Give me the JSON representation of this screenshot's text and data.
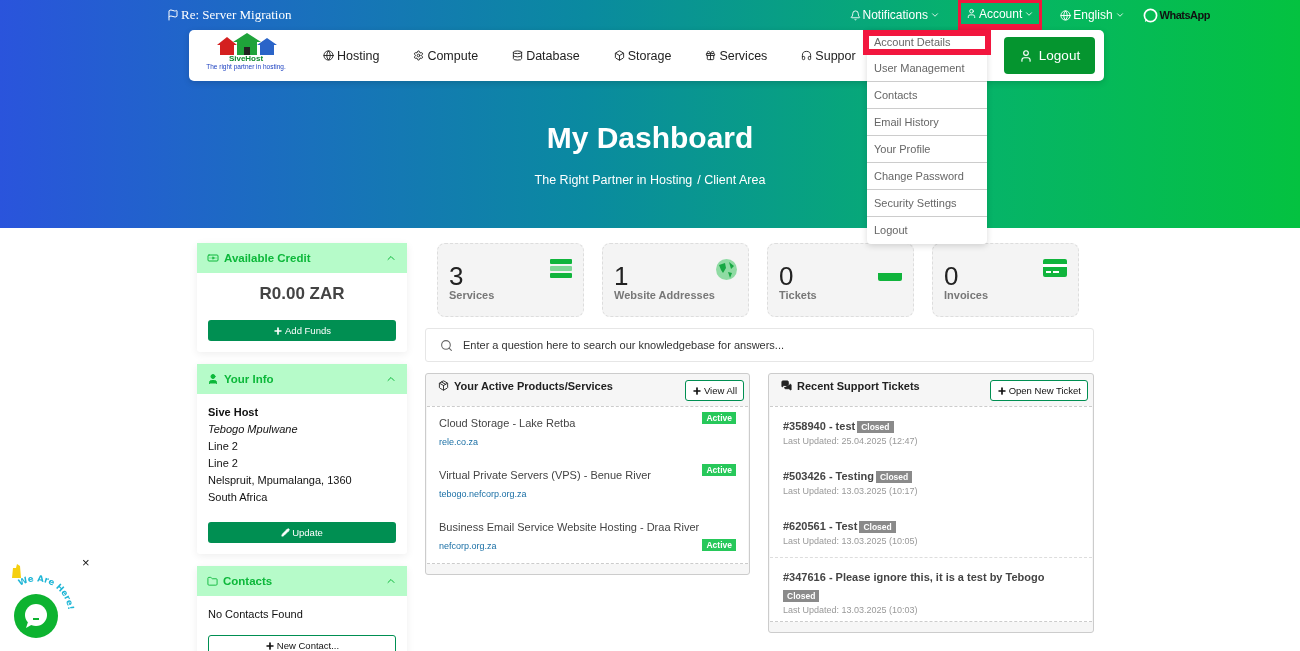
{
  "top_bar": {
    "announcement": "Re: Server Migration",
    "links": [
      {
        "label": "Notifications",
        "highlighted": false
      },
      {
        "label": "Account",
        "highlighted": true
      },
      {
        "label": "English",
        "highlighted": false
      }
    ],
    "whatsapp": "WhatsApp"
  },
  "logo": {
    "name": "SiveHost",
    "tagline": "The right partner in hosting."
  },
  "nav": [
    "Hosting",
    "Compute",
    "Database",
    "Storage",
    "Services",
    "Suppor"
  ],
  "logout_button": "Logout",
  "account_menu": [
    {
      "label": "Account Details",
      "highlighted": true
    },
    {
      "label": "User Management",
      "highlighted": false
    },
    {
      "label": "Contacts",
      "highlighted": false
    },
    {
      "label": "Email History",
      "highlighted": false
    },
    {
      "label": "Your Profile",
      "highlighted": false
    },
    {
      "label": "Change Password",
      "highlighted": false
    },
    {
      "label": "Security Settings",
      "highlighted": false
    },
    {
      "label": "Logout",
      "highlighted": false
    }
  ],
  "hero": {
    "title": "My Dashboard",
    "breadcrumb": [
      "The Right Partner in Hosting",
      "/ Client Area"
    ]
  },
  "credit_panel": {
    "title": "Available Credit",
    "amount": "R0.00 ZAR",
    "button": "Add Funds"
  },
  "info_panel": {
    "title": "Your Info",
    "company": "Sive Host",
    "contact": "Tebogo Mpulwane",
    "lines": [
      "Line 2",
      "Line 2",
      "Nelspruit, Mpumalanga, 1360",
      "South Africa"
    ],
    "button": "Update"
  },
  "contacts_panel": {
    "title": "Contacts",
    "empty": "No Contacts Found",
    "button": "New Contact..."
  },
  "stats": [
    {
      "value": "3",
      "label": "Services"
    },
    {
      "value": "1",
      "label": "Website Addresses"
    },
    {
      "value": "0",
      "label": "Tickets"
    },
    {
      "value": "0",
      "label": "Invoices"
    }
  ],
  "search": {
    "placeholder": "Enter a question here to search our knowledgebase for answers..."
  },
  "products": {
    "title": "Your Active Products/Services",
    "button": "View All",
    "items": [
      {
        "name": "Cloud Storage - Lake Retba",
        "domain": "rele.co.za",
        "status": "Active"
      },
      {
        "name": "Virtual Private Servers (VPS) - Benue River",
        "domain": "tebogo.nefcorp.org.za",
        "status": "Active"
      },
      {
        "name": "Business Email Service Website Hosting - Draa River",
        "domain": "nefcorp.org.za",
        "status": "Active"
      }
    ]
  },
  "tickets": {
    "title": "Recent Support Tickets",
    "button": "Open New Ticket",
    "items": [
      {
        "subject": "#358940 - test",
        "status": "Closed",
        "updated": "Last Updated: 25.04.2025 (12:47)"
      },
      {
        "subject": "#503426 - Testing",
        "status": "Closed",
        "updated": "Last Updated: 13.03.2025 (10:17)"
      },
      {
        "subject": "#620561 - Test",
        "status": "Closed",
        "updated": "Last Updated: 13.03.2025 (10:05)"
      },
      {
        "subject": "#347616 - Please ignore this, it is a test by Tebogo",
        "status": "Closed",
        "updated": "Last Updated: 13.03.2025 (10:03)"
      }
    ]
  },
  "chat_widget": {
    "caption": "We Are Here!",
    "close": "×"
  }
}
